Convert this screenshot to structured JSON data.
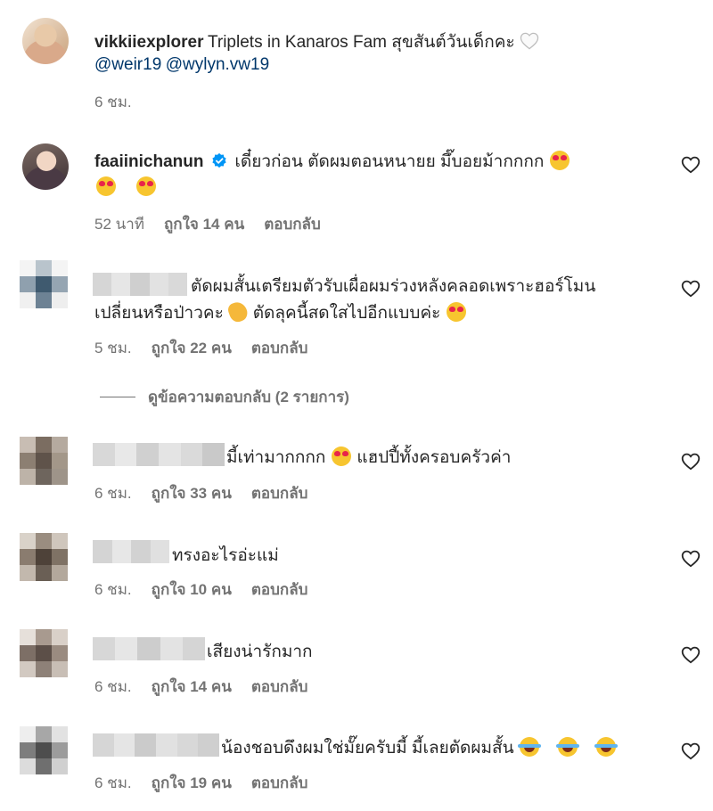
{
  "caption": {
    "username": "vikkiiexplorer",
    "text": "Triplets in Kanaros Fam สุขสันต์วันเด็กคะ ",
    "mention1": "@weir19",
    "mention2": "@wylyn.vw19",
    "time": "6 ชม."
  },
  "comments": [
    {
      "username": "faaiinichanun",
      "verified": true,
      "line1": "เดี๋ยวก่อน ตัดผมตอนหนายย มึ๊บอยม้ากกกก",
      "time": "52 นาที",
      "likes": "ถูกใจ 14 คน",
      "reply": "ตอบกลับ"
    },
    {
      "line1": "ตัดผมสั้นเตรียมตัวรับเผื่อผมร่วงหลังคลอดเพราะฮอร์โมน",
      "line2a": "เปลี่ยนหรือป่าวคะ",
      "line2b": "ตัดลุคนี้สดใสไปอีกแบบค่ะ",
      "time": "5 ชม.",
      "likes": "ถูกใจ 22 คน",
      "reply": "ตอบกลับ",
      "view_replies": "ดูข้อความตอบกลับ (2 รายการ)"
    },
    {
      "line1a": "มี้เท่ามากกกก",
      "line1b": " แฮปปี้ทั้งครอบครัวค่า",
      "time": "6 ชม.",
      "likes": "ถูกใจ 33 คน",
      "reply": "ตอบกลับ"
    },
    {
      "line1": "ทรงอะไรอ่ะแม่",
      "time": "6 ชม.",
      "likes": "ถูกใจ 10 คน",
      "reply": "ตอบกลับ"
    },
    {
      "line1": "เสียงน่ารักมาก",
      "time": "6 ชม.",
      "likes": "ถูกใจ 14 คน",
      "reply": "ตอบกลับ"
    },
    {
      "line1": "น้องชอบดึงผมใช่มั๊ยครับมี้ มี้เลยตัดผมสั้น",
      "time": "6 ชม.",
      "likes": "ถูกใจ 19 คน",
      "reply": "ตอบกลับ"
    }
  ],
  "colors": {
    "text": "#262626",
    "secondary": "#737373",
    "mention": "#00376b",
    "verified": "#0095f6"
  },
  "icons": [
    "heart-outline-icon",
    "verified-badge-icon",
    "heart-eyes-emoji",
    "clap-emoji",
    "laugh-cry-emoji"
  ]
}
